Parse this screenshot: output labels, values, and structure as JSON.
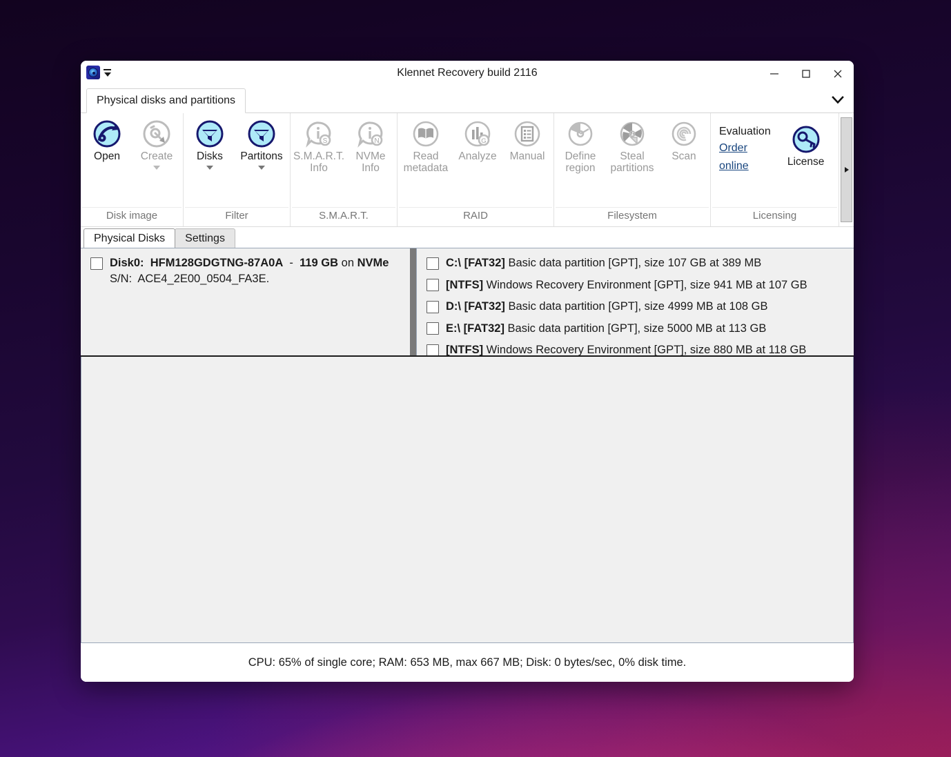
{
  "window": {
    "title": "Klennet Recovery build 2116",
    "app_icon": "disk-platter-icon",
    "minimize_label": "Minimize",
    "maximize_label": "Maximize",
    "close_label": "Close"
  },
  "ribbon": {
    "tab_label": "Physical disks and partitions",
    "collapse_label": "Collapse the Ribbon",
    "scroll_right_label": "Scroll right",
    "groups": [
      {
        "label": "Disk image",
        "items": [
          {
            "label": "Open",
            "icon": "open-disk-image-icon",
            "disabled": false,
            "has_menu": false
          },
          {
            "label": "Create",
            "icon": "create-disk-image-icon",
            "disabled": true,
            "has_menu": true
          }
        ]
      },
      {
        "label": "Filter",
        "items": [
          {
            "label": "Disks",
            "icon": "funnel-filter-icon",
            "disabled": false,
            "has_menu": true
          },
          {
            "label": "Partitions",
            "label_shown": "Partitons",
            "icon": "funnel-filter-icon",
            "disabled": false,
            "has_menu": true
          }
        ]
      },
      {
        "label": "S.M.A.R.T.",
        "items": [
          {
            "label": "S.M.A.R.T. Info",
            "icon": "smart-info-icon",
            "disabled": true,
            "has_menu": false
          },
          {
            "label": "NVMe Info",
            "icon": "nvme-info-icon",
            "disabled": true,
            "has_menu": false
          }
        ]
      },
      {
        "label": "RAID",
        "items": [
          {
            "label": "Read metadata",
            "icon": "book-icon",
            "disabled": true,
            "has_menu": false
          },
          {
            "label": "Analyze",
            "icon": "bar-chart-icon",
            "disabled": true,
            "has_menu": false
          },
          {
            "label": "Manual",
            "icon": "list-document-icon",
            "disabled": true,
            "has_menu": false
          }
        ]
      },
      {
        "label": "Filesystem",
        "items": [
          {
            "label": "Define region",
            "icon": "disk-region-icon",
            "disabled": true,
            "has_menu": false
          },
          {
            "label": "Steal partitions",
            "icon": "disk-partitions-icon",
            "disabled": true,
            "has_menu": false
          },
          {
            "label": "Scan",
            "icon": "scan-spiral-icon",
            "disabled": true,
            "has_menu": false
          }
        ]
      }
    ],
    "licensing": {
      "label": "Licensing",
      "status": "Evaluation",
      "order_link": "Order online",
      "license_button": "License",
      "license_icon": "key-icon"
    }
  },
  "content_tabs": [
    {
      "label": "Physical Disks",
      "active": true
    },
    {
      "label": "Settings",
      "active": false
    }
  ],
  "disks": {
    "list": [
      {
        "checked": false,
        "label_prefix": "Disk0:",
        "model": "HFM128GDGTNG-87A0A",
        "dash": "-",
        "size": "119 GB",
        "on": "on",
        "bus": "NVMe",
        "serial_label": "S/N:",
        "serial": "ACE4_2E00_0504_FA3E."
      }
    ]
  },
  "partitions": {
    "list": [
      {
        "checked": false,
        "drive": "C:\\ [FAT32]",
        "desc": "Basic data partition [GPT], size 107 GB at 389 MB"
      },
      {
        "checked": false,
        "drive": "[NTFS]",
        "desc": "Windows Recovery Environment [GPT], size 941 MB at 107 GB"
      },
      {
        "checked": false,
        "drive": "D:\\ [FAT32]",
        "desc": "Basic data partition [GPT], size 4999 MB at 108 GB"
      },
      {
        "checked": false,
        "drive": "E:\\ [FAT32]",
        "desc": "Basic data partition [GPT], size 5000 MB at 113 GB"
      },
      {
        "checked": false,
        "drive": "[NTFS]",
        "desc": "Windows Recovery Environment [GPT], size 880 MB at 118 GB"
      }
    ]
  },
  "statusbar": {
    "text": "CPU: 65% of single core; RAM: 653 MB, max 667 MB; Disk: 0 bytes/sec, 0% disk time."
  },
  "colors": {
    "accent_blue": "#18457e",
    "icon_dark_blue": "#16186e",
    "icon_cyan": "#aeeaf8",
    "disabled_gray": "#9a9a9a"
  }
}
